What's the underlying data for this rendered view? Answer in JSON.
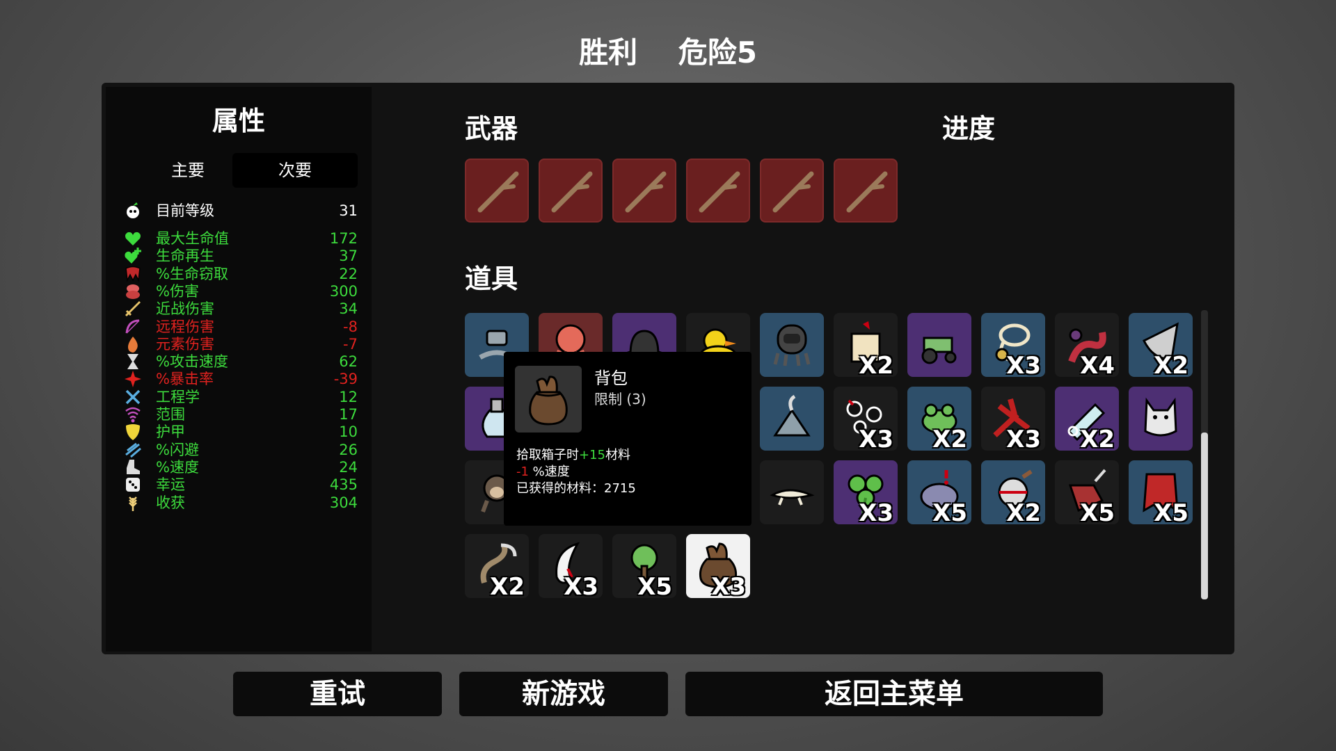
{
  "header": {
    "result": "胜利",
    "danger": "危险5"
  },
  "stats": {
    "title": "属性",
    "tabs": {
      "primary": "主要",
      "secondary": "次要"
    },
    "level": {
      "label": "目前等级",
      "value": "31"
    },
    "rows": [
      {
        "label": "最大生命值",
        "value": "172",
        "color": "#3ddc3d",
        "icon": "heart-icon"
      },
      {
        "label": "生命再生",
        "value": "37",
        "color": "#3ddc3d",
        "icon": "heart-plus-icon"
      },
      {
        "label": "%生命窃取",
        "value": "22",
        "color": "#3ddc3d",
        "icon": "fangs-icon"
      },
      {
        "label": "%伤害",
        "value": "300",
        "color": "#3ddc3d",
        "icon": "muscle-icon"
      },
      {
        "label": "近战伤害",
        "value": "34",
        "color": "#3ddc3d",
        "icon": "sword-icon"
      },
      {
        "label": "远程伤害",
        "value": "-8",
        "color": "#e0221f",
        "icon": "bow-icon"
      },
      {
        "label": "元素伤害",
        "value": "-7",
        "color": "#e0221f",
        "icon": "flame-icon"
      },
      {
        "label": "%攻击速度",
        "value": "62",
        "color": "#3ddc3d",
        "icon": "hourglass-icon"
      },
      {
        "label": "%暴击率",
        "value": "-39",
        "color": "#e0221f",
        "icon": "crit-icon"
      },
      {
        "label": "工程学",
        "value": "12",
        "color": "#3ddc3d",
        "icon": "wrench-icon"
      },
      {
        "label": "范围",
        "value": "17",
        "color": "#3ddc3d",
        "icon": "range-icon"
      },
      {
        "label": "护甲",
        "value": "10",
        "color": "#3ddc3d",
        "icon": "shield-icon"
      },
      {
        "label": "%闪避",
        "value": "26",
        "color": "#3ddc3d",
        "icon": "dodge-icon"
      },
      {
        "label": "%速度",
        "value": "24",
        "color": "#3ddc3d",
        "icon": "boot-icon"
      },
      {
        "label": "幸运",
        "value": "435",
        "color": "#3ddc3d",
        "icon": "dice-icon"
      },
      {
        "label": "收获",
        "value": "304",
        "color": "#3ddc3d",
        "icon": "wheat-icon"
      }
    ]
  },
  "sections": {
    "weapons": "武器",
    "progress": "进度",
    "items": "道具"
  },
  "weapons": [
    {
      "icon": "stick-icon"
    },
    {
      "icon": "stick-icon"
    },
    {
      "icon": "stick-icon"
    },
    {
      "icon": "stick-icon"
    },
    {
      "icon": "stick-icon"
    },
    {
      "icon": "stick-icon"
    }
  ],
  "items": [
    {
      "icon": "robot-arm-icon",
      "tier": "blue",
      "qty": ""
    },
    {
      "icon": "octopus-icon",
      "tier": "red",
      "qty": ""
    },
    {
      "icon": "bowler-hat-icon",
      "tier": "purple",
      "qty": ""
    },
    {
      "icon": "duck-icon",
      "tier": "black",
      "qty": ""
    },
    {
      "icon": "diving-helmet-icon",
      "tier": "blue",
      "qty": ""
    },
    {
      "icon": "scroll-icon",
      "tier": "black",
      "qty": "X2"
    },
    {
      "icon": "tractor-icon",
      "tier": "purple",
      "qty": ""
    },
    {
      "icon": "lasso-icon",
      "tier": "blue",
      "qty": "X3"
    },
    {
      "icon": "tentacle-icon",
      "tier": "black",
      "qty": "X4"
    },
    {
      "icon": "horn-icon",
      "tier": "blue",
      "qty": "X2"
    },
    {
      "icon": "potion-icon",
      "tier": "purple",
      "qty": ""
    },
    {
      "icon": "",
      "tier": "black",
      "qty": ""
    },
    {
      "icon": "",
      "tier": "black",
      "qty": ""
    },
    {
      "icon": "",
      "tier": "black",
      "qty": ""
    },
    {
      "icon": "campfire-icon",
      "tier": "blue",
      "qty": ""
    },
    {
      "icon": "eyes-icon",
      "tier": "black",
      "qty": "X3"
    },
    {
      "icon": "frog-icon",
      "tier": "blue",
      "qty": "X2"
    },
    {
      "icon": "claw-icon",
      "tier": "black",
      "qty": "X3"
    },
    {
      "icon": "bottle-icon",
      "tier": "purple",
      "qty": "X2"
    },
    {
      "icon": "cat-icon",
      "tier": "purple",
      "qty": ""
    },
    {
      "icon": "monkey-icon",
      "tier": "black",
      "qty": ""
    },
    {
      "icon": "",
      "tier": "black",
      "qty": ""
    },
    {
      "icon": "",
      "tier": "black",
      "qty": ""
    },
    {
      "icon": "",
      "tier": "black",
      "qty": ""
    },
    {
      "icon": "lizard-icon",
      "tier": "black",
      "qty": ""
    },
    {
      "icon": "clover-icon",
      "tier": "purple",
      "qty": "X3"
    },
    {
      "icon": "toxic-sack-icon",
      "tier": "blue",
      "qty": "X5"
    },
    {
      "icon": "grinder-icon",
      "tier": "blue",
      "qty": "X2"
    },
    {
      "icon": "glove-icon",
      "tier": "black",
      "qty": "X5"
    },
    {
      "icon": "cape-icon",
      "tier": "blue",
      "qty": "X5"
    },
    {
      "icon": "scythe-icon",
      "tier": "black",
      "qty": "X2"
    },
    {
      "icon": "fang-icon",
      "tier": "black",
      "qty": "X3"
    },
    {
      "icon": "tree-icon",
      "tier": "black",
      "qty": "X5"
    },
    {
      "icon": "bag-icon",
      "tier": "white",
      "qty": "X3"
    }
  ],
  "tooltip": {
    "name": "背包",
    "limit": "限制 (3)",
    "effect1_pre": "拾取箱子时",
    "effect1_val": "+15",
    "effect1_post": "材料",
    "effect2_val": "-1",
    "effect2_post": " %速度",
    "collected": "已获得的材料：2715",
    "icon": "bag-icon"
  },
  "buttons": {
    "retry": "重试",
    "new_game": "新游戏",
    "main_menu": "返回主菜单"
  },
  "colors": {
    "positive": "#3ddc3d",
    "negative": "#e0221f",
    "weapon_slot": "#6a1f1f",
    "tier_blue": "#2e4f6a",
    "tier_purple": "#4d2f73"
  }
}
